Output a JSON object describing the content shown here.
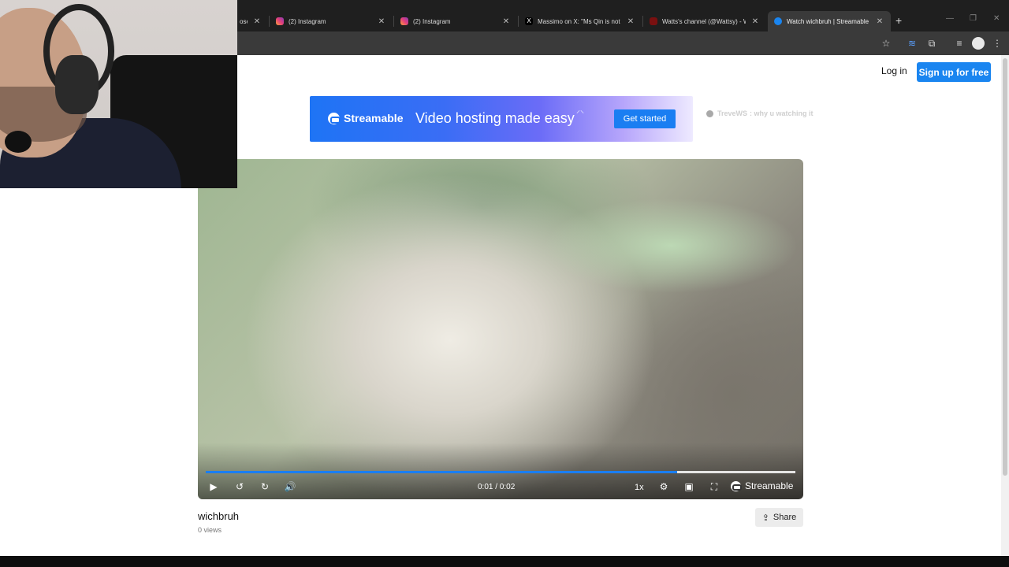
{
  "browser": {
    "tabs": [
      {
        "title": "ose",
        "active": false
      },
      {
        "title": "(2) Instagram",
        "active": false
      },
      {
        "title": "(2) Instagram",
        "active": false
      },
      {
        "title": "Massimo on X: \"Ms Qin is not a",
        "active": false
      },
      {
        "title": "Watts's channel (@Wattsy) - W",
        "active": false
      },
      {
        "title": "Watch wichbruh | Streamable",
        "active": true
      }
    ],
    "close_glyph": "✕",
    "new_tab_glyph": "+",
    "window_controls": [
      "—",
      "❐",
      "✕"
    ]
  },
  "header": {
    "login_label": "Log in",
    "signup_label": "Sign up for free"
  },
  "banner": {
    "brand": "Streamable",
    "headline": "Video hosting made easy",
    "cta": "Get started"
  },
  "overlay_message": {
    "user": "TreveWS",
    "text": ": why u watching it"
  },
  "player": {
    "progress_fraction": 0.8,
    "time": "0:01 / 0:02",
    "speed": "1x",
    "brand": "Streamable",
    "icons": [
      "play-icon",
      "rewind-icon",
      "forward-icon",
      "volume-icon",
      "settings-icon",
      "pip-icon",
      "fullscreen-icon"
    ]
  },
  "video": {
    "title": "wichbruh",
    "views": "0 views"
  },
  "share_label": "Share",
  "colors": {
    "accent": "#1a85f0",
    "progress": "#1a7ef2"
  }
}
